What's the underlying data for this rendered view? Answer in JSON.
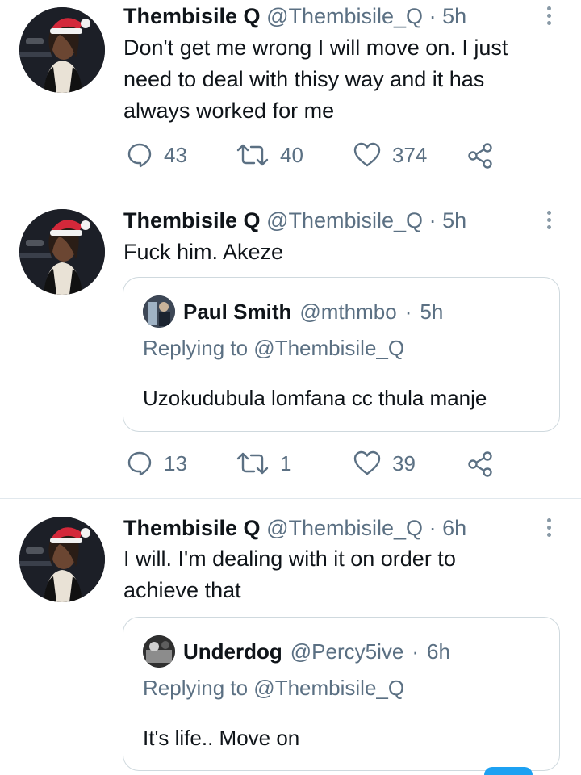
{
  "colors": {
    "text": "#0f1419",
    "muted": "#5b7083",
    "border": "#cfd9de",
    "brand": "#1da1f2"
  },
  "tweets": [
    {
      "name": "Thembisile Q",
      "handle": "@Thembisile_Q",
      "dot": "·",
      "time": "5h",
      "lines": [
        "Don't get me wrong I will move on. I just",
        "need to deal with thisy way and it has",
        "always worked for me"
      ],
      "replies": "43",
      "retweets": "40",
      "likes": "374"
    },
    {
      "name": "Thembisile Q",
      "handle": "@Thembisile_Q",
      "dot": "·",
      "time": "5h",
      "lines": [
        "Fuck him. Akeze"
      ],
      "quote": {
        "name": "Paul Smith",
        "handle": "@mthmbo",
        "dot": "·",
        "time": "5h",
        "replying": "Replying to @Thembisile_Q",
        "text": "Uzokudubula lomfana cc thula manje"
      },
      "replies": "13",
      "retweets": "1",
      "likes": "39"
    },
    {
      "name": "Thembisile Q",
      "handle": "@Thembisile_Q",
      "dot": "·",
      "time": "6h",
      "lines": [
        "I will. I'm dealing with it on order to",
        "achieve that"
      ],
      "quote": {
        "name": "Underdog",
        "handle": "@Percy5ive",
        "dot": "·",
        "time": "6h",
        "replying": "Replying to @Thembisile_Q",
        "text": "It's life.. Move on"
      }
    }
  ]
}
